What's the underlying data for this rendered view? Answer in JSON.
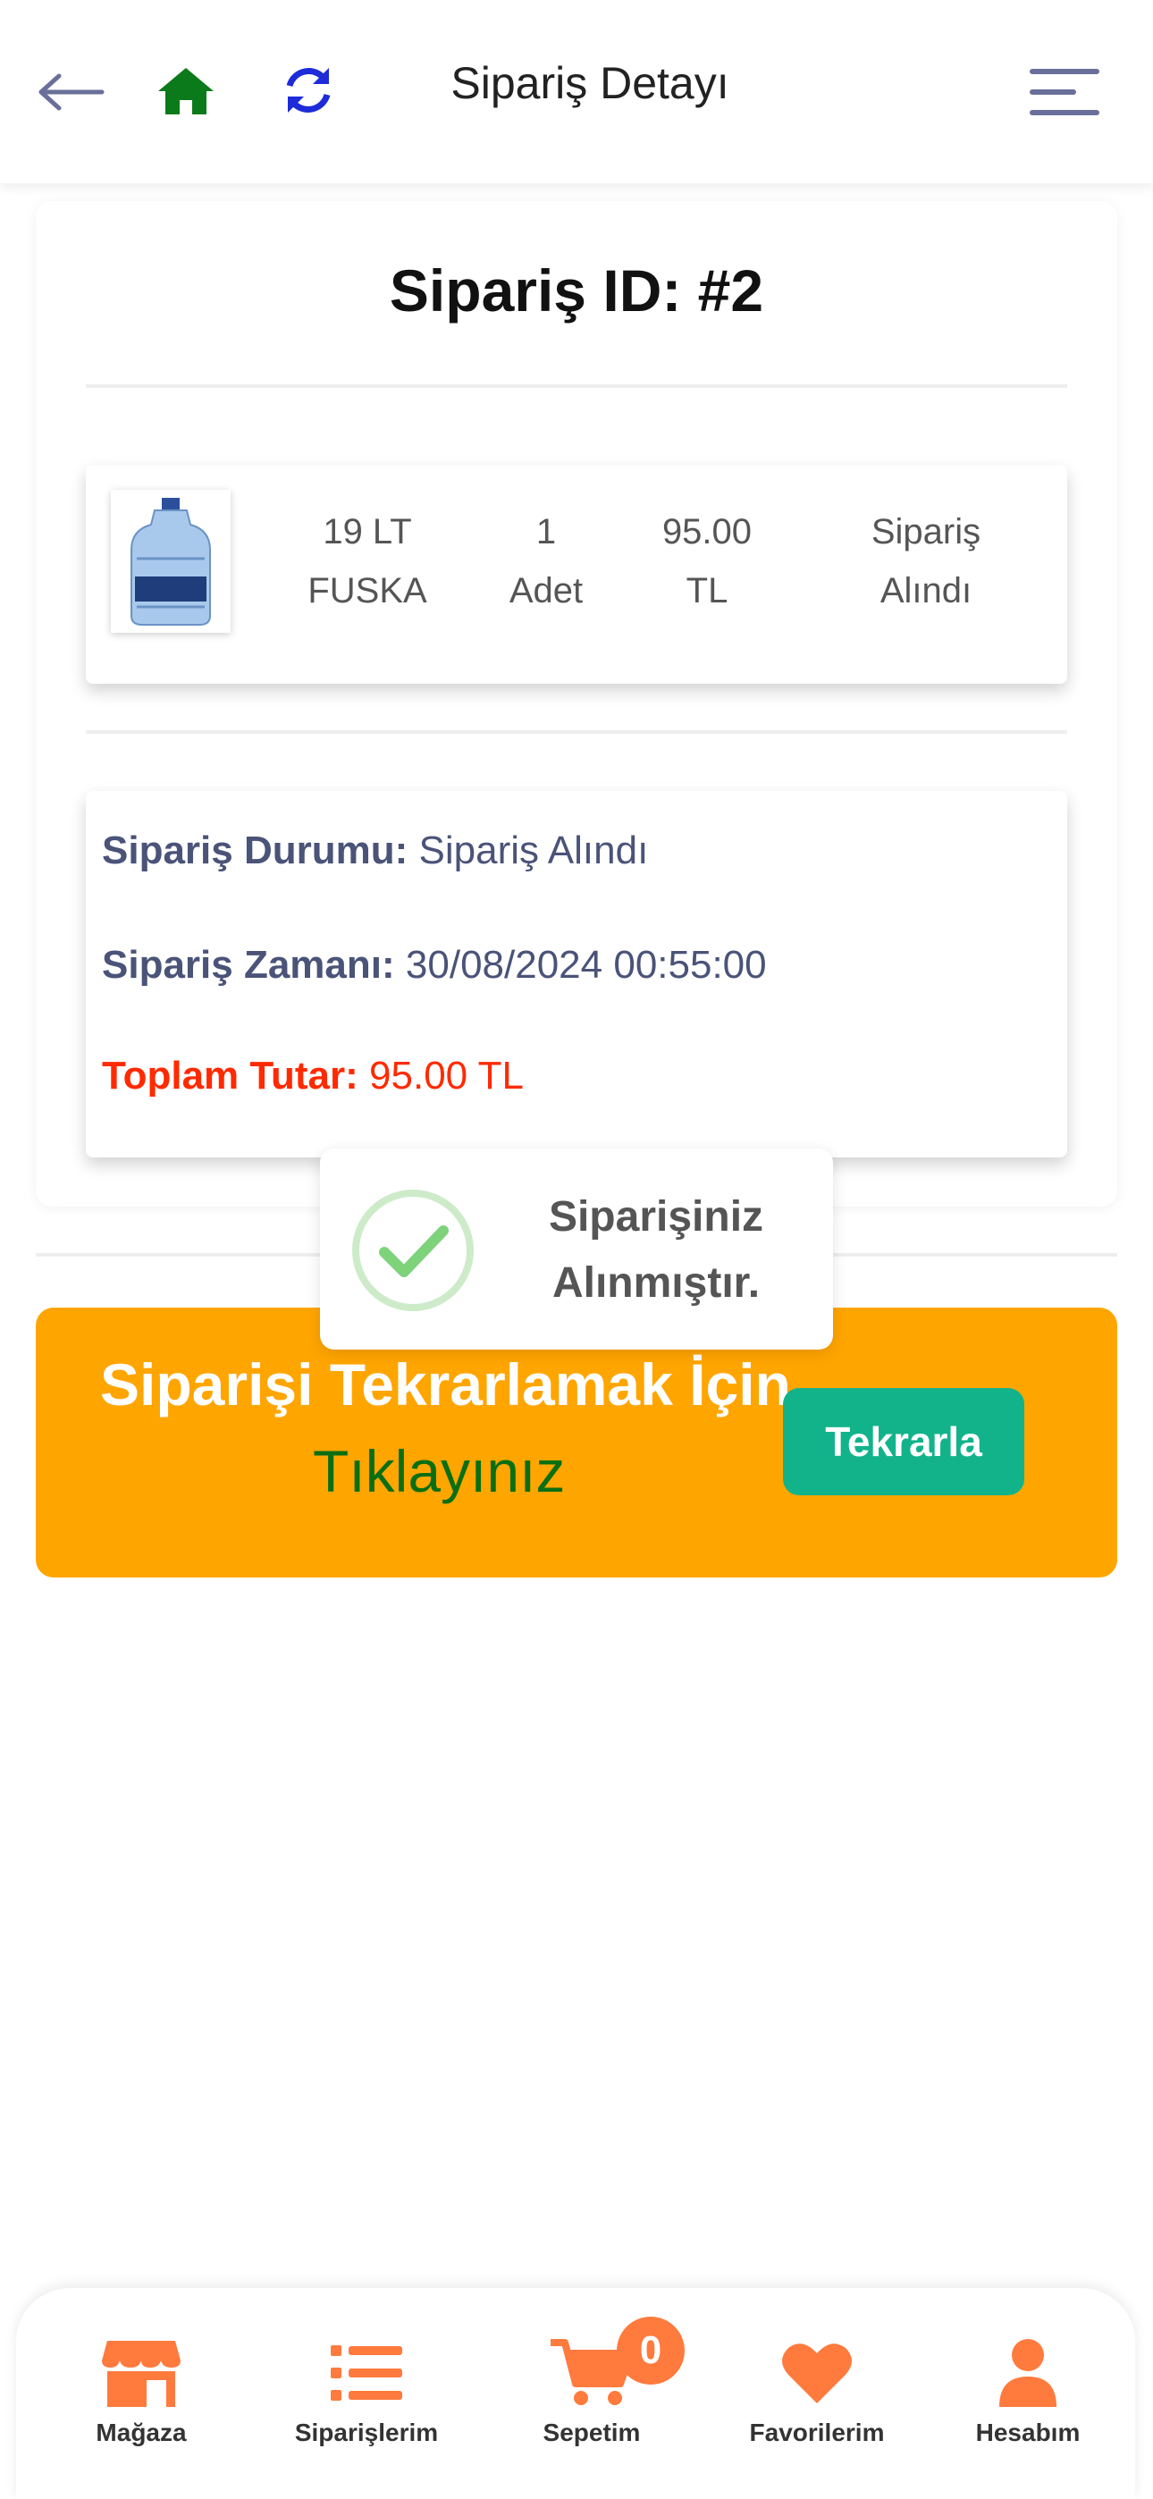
{
  "header": {
    "title": "Sipariş Detayı",
    "icons": [
      "arrow-left-icon",
      "home-icon",
      "refresh-icon",
      "menu-icon"
    ]
  },
  "order": {
    "id_label": "Sipariş ID: #2",
    "item": {
      "name_line1": "19 LT",
      "name_line2": "FUSKA",
      "qty_line1": "1",
      "qty_line2": "Adet",
      "price_line1": "95.00",
      "price_line2": "TL",
      "status_line1": "Sipariş",
      "status_line2": "Alındı"
    },
    "info": {
      "status_label": "Sipariş Durumu:",
      "status_value": "Sipariş Alındı",
      "time_label": "Sipariş Zamanı:",
      "time_value": "30/08/2024 00:55:00",
      "total_label": "Toplam Tutar:",
      "total_value": "95.00 TL"
    }
  },
  "toast": {
    "line1": "Siparişiniz",
    "line2": "Alınmıştır."
  },
  "repeat": {
    "line1": "Siparişi Tekrarlamak İçin",
    "line2": "Tıklayınız",
    "button": "Tekrarla"
  },
  "bottom_nav": {
    "items": [
      {
        "label": "Mağaza",
        "icon": "store-icon"
      },
      {
        "label": "Siparişlerim",
        "icon": "list-icon"
      },
      {
        "label": "Sepetim",
        "icon": "cart-icon"
      },
      {
        "label": "Favorilerim",
        "icon": "heart-icon"
      },
      {
        "label": "Hesabım",
        "icon": "user-icon"
      }
    ],
    "cart_count": "0"
  },
  "colors": {
    "accent_orange": "#ffa500",
    "button_green": "#12b38b",
    "nav_orange": "#ff7a3d",
    "total_red": "#ff2a00"
  }
}
